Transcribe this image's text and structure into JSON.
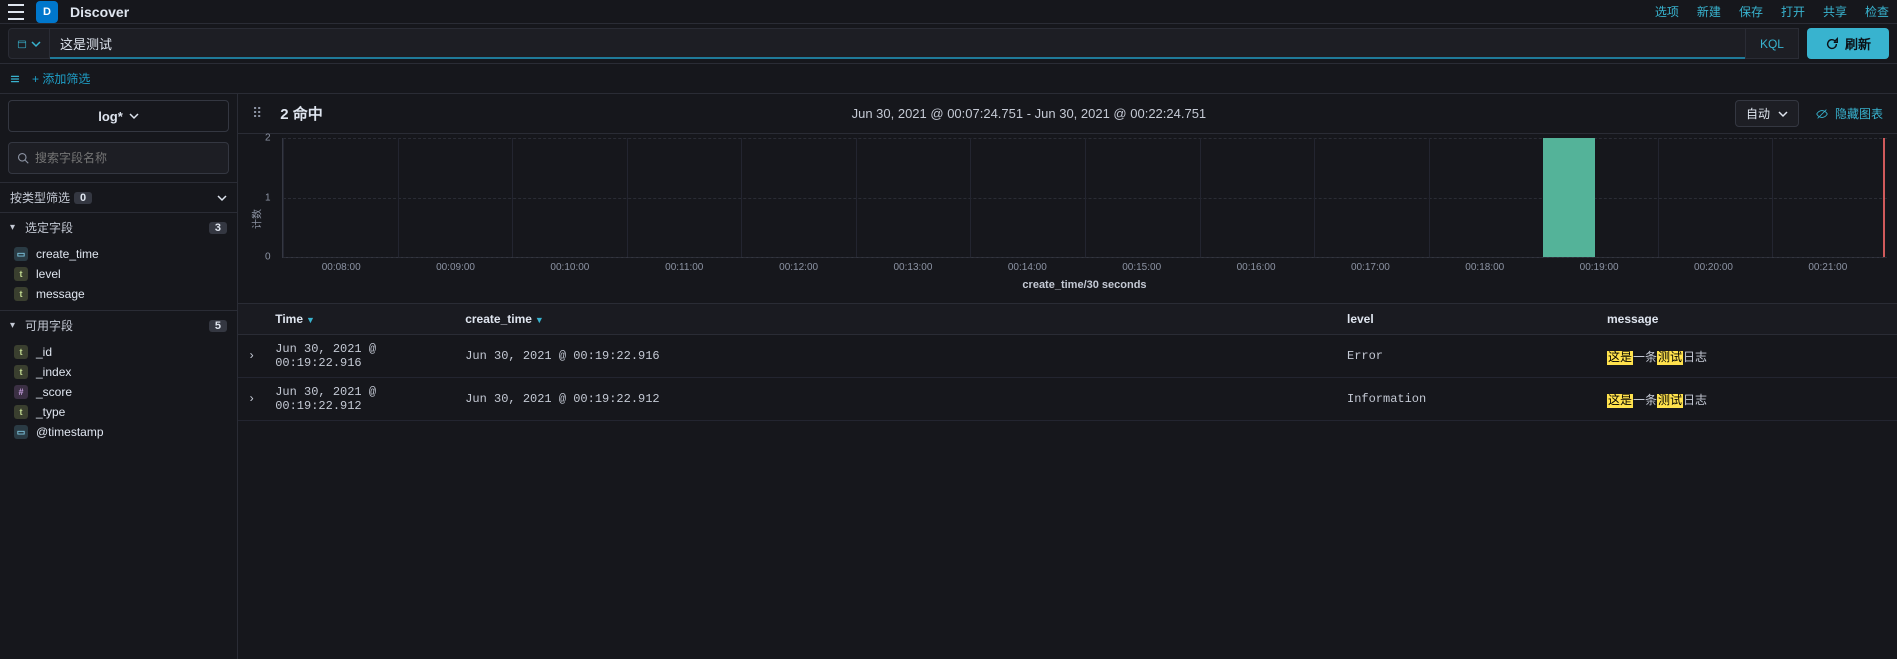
{
  "breadcrumb": "Discover",
  "topnav_links": [
    "选项",
    "新建",
    "保存",
    "打开",
    "共享",
    "检查"
  ],
  "query_value": "这是测试",
  "kql_label": "KQL",
  "refresh_label": "刷新",
  "add_filter_label": "+ 添加筛选",
  "index_pattern": "log*",
  "field_search_placeholder": "搜索字段名称",
  "type_filter": {
    "label": "按类型筛选",
    "count": "0"
  },
  "selected_fields": {
    "label": "选定字段",
    "count": "3",
    "items": [
      {
        "type": "d",
        "glyph": "▭",
        "name": "create_time"
      },
      {
        "type": "t",
        "glyph": "t",
        "name": "level"
      },
      {
        "type": "t",
        "glyph": "t",
        "name": "message"
      }
    ]
  },
  "available_fields": {
    "label": "可用字段",
    "count": "5",
    "items": [
      {
        "type": "t",
        "glyph": "t",
        "name": "_id"
      },
      {
        "type": "t",
        "glyph": "t",
        "name": "_index"
      },
      {
        "type": "n",
        "glyph": "#",
        "name": "_score"
      },
      {
        "type": "t",
        "glyph": "t",
        "name": "_type"
      },
      {
        "type": "d",
        "glyph": "▭",
        "name": "@timestamp"
      }
    ]
  },
  "hits": {
    "count": "2",
    "suffix": "命中"
  },
  "timerange": "Jun 30, 2021 @ 00:07:24.751 - Jun 30, 2021 @ 00:22:24.751",
  "interval_label": "自动",
  "hide_chart_label": "隐藏图表",
  "chart_ylabel": "计数",
  "chart_xlabel": "create_time/30 seconds",
  "table": {
    "columns": [
      "Time",
      "create_time",
      "level",
      "message"
    ],
    "rows": [
      {
        "time": "Jun 30, 2021 @ 00:19:22.916",
        "create_time": "Jun 30, 2021 @ 00:19:22.916",
        "level": "Error",
        "message_hl1": "这是",
        "message_mid": "一条",
        "message_hl2": "测试",
        "message_tail": "日志"
      },
      {
        "time": "Jun 30, 2021 @ 00:19:22.912",
        "create_time": "Jun 30, 2021 @ 00:19:22.912",
        "level": "Information",
        "message_hl1": "这是",
        "message_mid": "一条",
        "message_hl2": "测试",
        "message_tail": "日志"
      }
    ]
  },
  "chart_data": {
    "type": "bar",
    "title": "",
    "xlabel": "create_time/30 seconds",
    "ylabel": "计数",
    "ylim": [
      0,
      2
    ],
    "yticks": [
      0,
      1,
      2
    ],
    "categories": [
      "00:08:00",
      "00:09:00",
      "00:10:00",
      "00:11:00",
      "00:12:00",
      "00:13:00",
      "00:14:00",
      "00:15:00",
      "00:16:00",
      "00:17:00",
      "00:18:00",
      "00:19:00",
      "00:20:00",
      "00:21:00"
    ],
    "values": [
      0,
      0,
      0,
      0,
      0,
      0,
      0,
      0,
      0,
      0,
      0,
      2,
      0,
      0
    ]
  }
}
